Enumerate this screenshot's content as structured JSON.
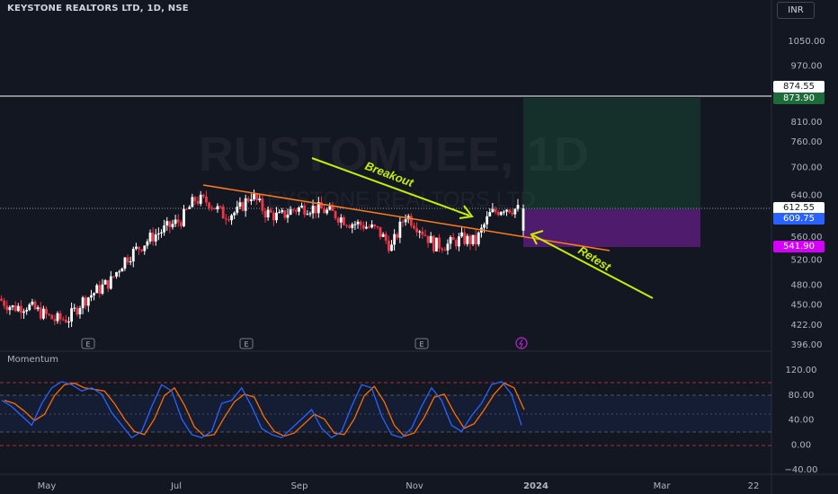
{
  "header": {
    "title": "KEYSTONE REALTORS LTD, 1D, NSE",
    "currency": "INR",
    "watermark_symbol": "RUSTOMJEE, 1D",
    "watermark_name": "KEYSTONE REALTORS LTD"
  },
  "price_axis": {
    "ticks": [
      "1050.00",
      "970.00",
      "810.00",
      "760.00",
      "700.00",
      "640.00",
      "560.00",
      "520.00",
      "480.00",
      "450.00",
      "422.00",
      "396.00"
    ],
    "labels": {
      "line_level": "874.55",
      "target": "873.90",
      "last": "612.55",
      "current": "609.75",
      "stop": "541.90"
    }
  },
  "time_axis": {
    "labels": [
      "May",
      "Jul",
      "Sep",
      "Nov",
      "2024",
      "Mar",
      "22"
    ]
  },
  "earnings_marker": "E",
  "indicator": {
    "name": "Momentum",
    "ticks": [
      "120.00",
      "80.00",
      "40.00",
      "0.00",
      "−40.00"
    ]
  },
  "annotations": {
    "breakout": "Breakout",
    "retest": "Retest"
  },
  "colors": {
    "background": "#131722",
    "up": "#ffffff",
    "down": "#f23645",
    "trendline": "#ff7b1c",
    "arrow": "#c6f000",
    "target_zone": "#1b5e3b",
    "stop_zone": "#5b1c7a",
    "stoch_k": "#2962ff",
    "stoch_d": "#ff6d00"
  },
  "chart_data": {
    "type": "candlestick",
    "title": "KEYSTONE REALTORS LTD, 1D, NSE",
    "scale": "log",
    "ylim": [
      396,
      1100
    ],
    "overlays": {
      "horizontal_line": 874.55,
      "trendline": [
        {
          "date": "2023-06-21",
          "price": 660
        },
        {
          "date": "2023-12-15",
          "price": 535
        }
      ],
      "position": {
        "entry": 609.75,
        "target": 873.9,
        "stop": 541.9,
        "from": "2023-12-20",
        "to": "2024-02-09"
      }
    },
    "candles": [
      {
        "d": "2023-04-03",
        "c": 458
      },
      {
        "d": "2023-04-10",
        "c": 445
      },
      {
        "d": "2023-04-17",
        "c": 448
      },
      {
        "d": "2023-04-24",
        "c": 438
      },
      {
        "d": "2023-05-01",
        "c": 428
      },
      {
        "d": "2023-05-08",
        "c": 430
      },
      {
        "d": "2023-05-15",
        "c": 455
      },
      {
        "d": "2023-05-22",
        "c": 470
      },
      {
        "d": "2023-05-29",
        "c": 485
      },
      {
        "d": "2023-06-05",
        "c": 520
      },
      {
        "d": "2023-06-12",
        "c": 540
      },
      {
        "d": "2023-06-19",
        "c": 560
      },
      {
        "d": "2023-06-26",
        "c": 575
      },
      {
        "d": "2023-07-03",
        "c": 590
      },
      {
        "d": "2023-07-10",
        "c": 630
      },
      {
        "d": "2023-07-17",
        "c": 625
      },
      {
        "d": "2023-07-24",
        "c": 600
      },
      {
        "d": "2023-07-31",
        "c": 605
      },
      {
        "d": "2023-08-07",
        "c": 640
      },
      {
        "d": "2023-08-14",
        "c": 605
      },
      {
        "d": "2023-08-21",
        "c": 595
      },
      {
        "d": "2023-08-28",
        "c": 610
      },
      {
        "d": "2023-09-04",
        "c": 615
      },
      {
        "d": "2023-09-11",
        "c": 610
      },
      {
        "d": "2023-09-18",
        "c": 600
      },
      {
        "d": "2023-09-25",
        "c": 585
      },
      {
        "d": "2023-10-02",
        "c": 580
      },
      {
        "d": "2023-10-09",
        "c": 570
      },
      {
        "d": "2023-10-16",
        "c": 540
      },
      {
        "d": "2023-10-23",
        "c": 600
      },
      {
        "d": "2023-10-30",
        "c": 575
      },
      {
        "d": "2023-11-06",
        "c": 545
      },
      {
        "d": "2023-11-13",
        "c": 545
      },
      {
        "d": "2023-11-20",
        "c": 555
      },
      {
        "d": "2023-11-27",
        "c": 550
      },
      {
        "d": "2023-12-04",
        "c": 600
      },
      {
        "d": "2023-12-11",
        "c": 615
      },
      {
        "d": "2023-12-18",
        "c": 609.75
      }
    ],
    "momentum": [
      70,
      60,
      45,
      30,
      65,
      90,
      100,
      95,
      85,
      90,
      80,
      50,
      30,
      10,
      20,
      60,
      95,
      85,
      40,
      15,
      10,
      20,
      65,
      70,
      90,
      60,
      25,
      15,
      10,
      25,
      40,
      55,
      25,
      10,
      20,
      60,
      95,
      90,
      45,
      15,
      10,
      25,
      60,
      90,
      70,
      30,
      20,
      45,
      65,
      95,
      100,
      80,
      30
    ]
  }
}
